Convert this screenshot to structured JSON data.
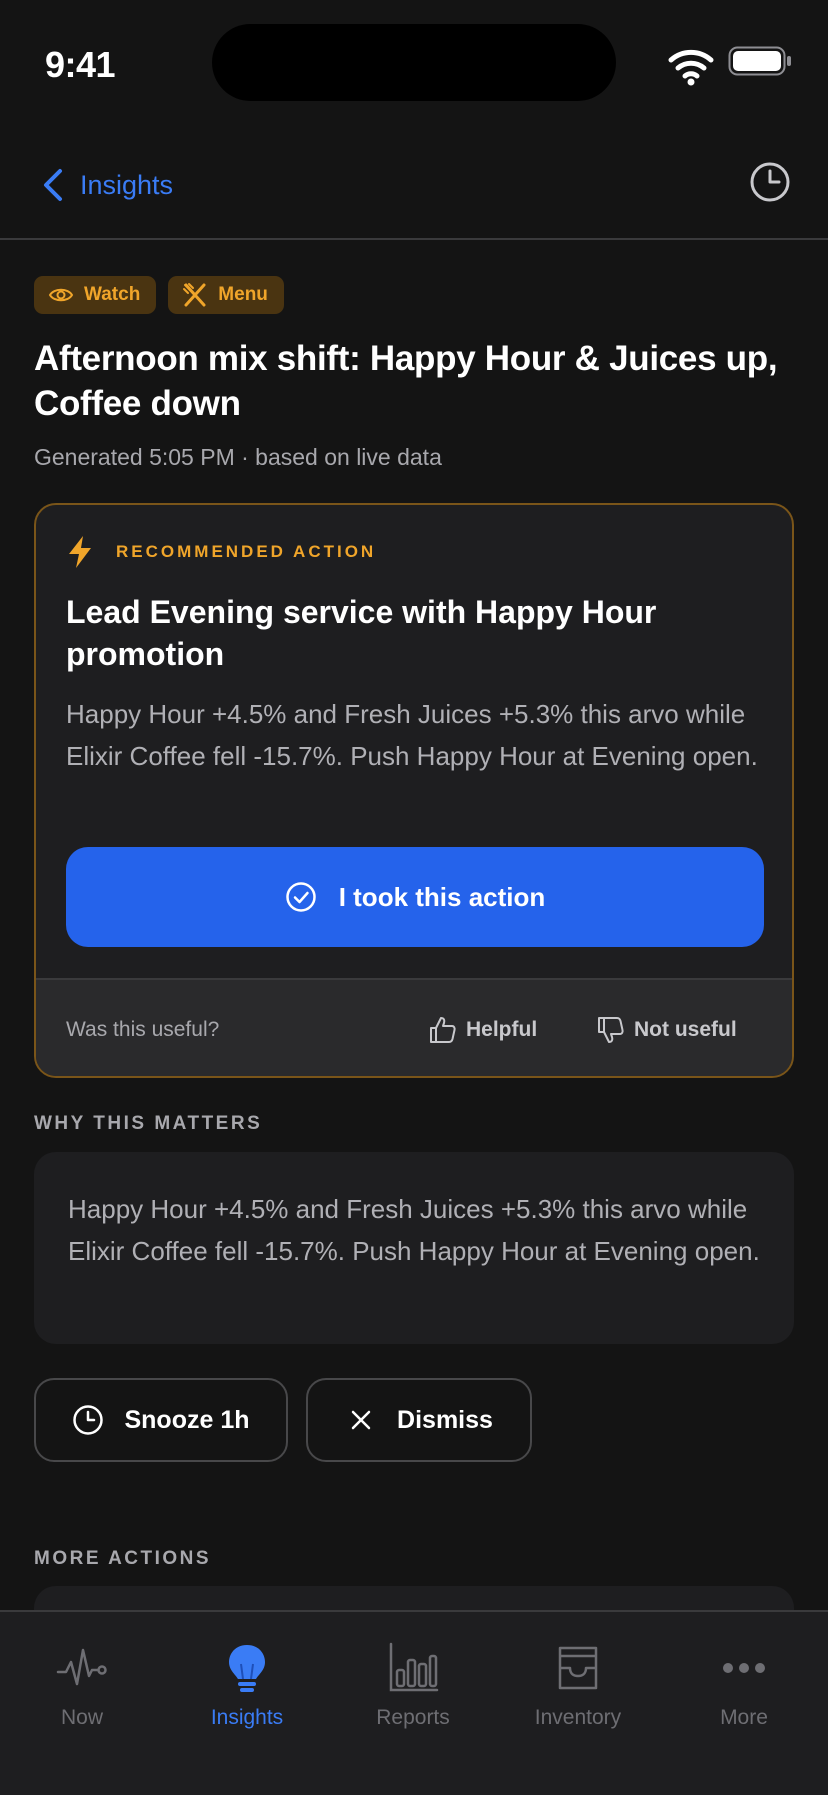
{
  "status_bar": {
    "time": "9:41"
  },
  "nav": {
    "back_label": "Insights"
  },
  "tags": [
    {
      "label": "Watch",
      "icon": "eye-icon"
    },
    {
      "label": "Menu",
      "icon": "utensils-icon"
    }
  ],
  "insight": {
    "title": "Afternoon mix shift: Happy Hour & Juices up, Coffee down",
    "subtitle": "Generated 5:05 PM · based on live data"
  },
  "action_card": {
    "eyebrow": "RECOMMENDED ACTION",
    "title": "Lead Evening service with Happy Hour promotion",
    "body": "Happy Hour +4.5% and Fresh Juices +5.3% this arvo while Elixir Coffee fell -15.7%. Push Happy Hour at Evening open.",
    "primary_label": "I took this action",
    "feedback_question": "Was this useful?",
    "helpful_label": "Helpful",
    "not_useful_label": "Not useful"
  },
  "why": {
    "label": "WHY THIS MATTERS",
    "body": "Happy Hour +4.5% and Fresh Juices +5.3% this arvo while Elixir Coffee fell -15.7%. Push Happy Hour at Evening open."
  },
  "secondary_actions": {
    "snooze_label": "Snooze 1h",
    "dismiss_label": "Dismiss"
  },
  "more_actions": {
    "label": "MORE ACTIONS"
  },
  "tab_bar": {
    "active": "Insights",
    "tabs": [
      {
        "label": "Now",
        "icon": "pulse-icon"
      },
      {
        "label": "Insights",
        "icon": "lightbulb-icon"
      },
      {
        "label": "Reports",
        "icon": "bar-chart-icon"
      },
      {
        "label": "Inventory",
        "icon": "inventory-tray-icon"
      },
      {
        "label": "More",
        "icon": "ellipsis-icon"
      }
    ]
  },
  "colors": {
    "background": "#141414",
    "accent_blue": "#2563eb",
    "link_blue": "#3a7cf5",
    "warning_amber": "#f0a52a",
    "card_border": "#7a5519"
  }
}
